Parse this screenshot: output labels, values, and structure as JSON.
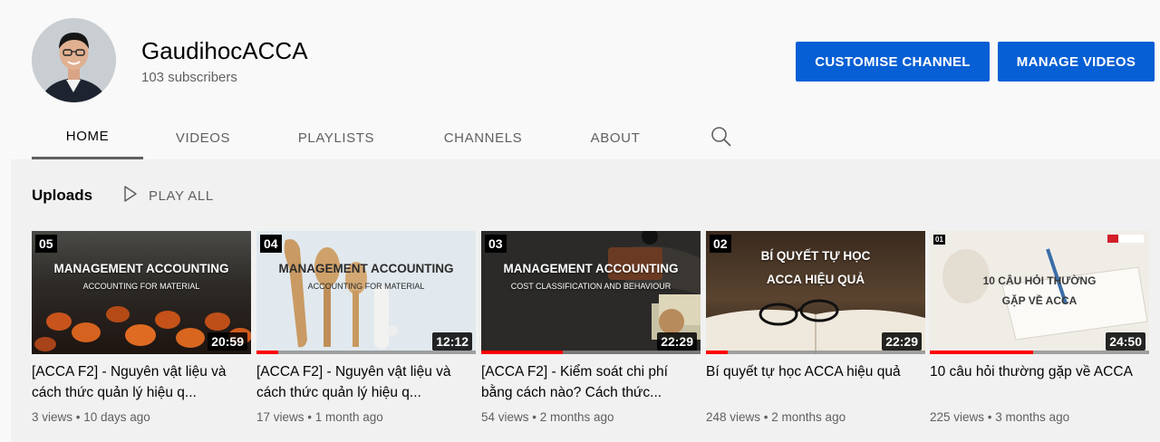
{
  "channel": {
    "name": "GaudihocACCA",
    "subscribers": "103 subscribers",
    "customise_label": "CUSTOMISE CHANNEL",
    "manage_label": "MANAGE VIDEOS"
  },
  "tabs": [
    {
      "label": "HOME",
      "active": true
    },
    {
      "label": "VIDEOS",
      "active": false
    },
    {
      "label": "PLAYLISTS",
      "active": false
    },
    {
      "label": "CHANNELS",
      "active": false
    },
    {
      "label": "ABOUT",
      "active": false
    }
  ],
  "shelf": {
    "title": "Uploads",
    "play_all": "PLAY ALL"
  },
  "videos": [
    {
      "episode": "05",
      "thumb_title": "MANAGEMENT ACCOUNTING",
      "thumb_sub": "ACCOUNTING FOR MATERIAL",
      "duration": "20:59",
      "watched": 0,
      "title": "[ACCA F2] - Nguyên vật liệu và cách thức quản lý hiệu q...",
      "views": "3 views",
      "age": "10 days ago"
    },
    {
      "episode": "04",
      "thumb_title": "MANAGEMENT ACCOUNTING",
      "thumb_sub": "ACCOUNTING FOR MATERIAL",
      "duration": "12:12",
      "watched": 0.1,
      "title": "[ACCA F2] - Nguyên vật liệu và cách thức quản lý hiệu q...",
      "views": "17 views",
      "age": "1 month ago"
    },
    {
      "episode": "03",
      "thumb_title": "MANAGEMENT ACCOUNTING",
      "thumb_sub": "COST CLASSIFICATION AND BEHAVIOUR",
      "duration": "22:29",
      "watched": 0.37,
      "title": "[ACCA F2] - Kiểm soát chi phí bằng cách nào? Cách thức...",
      "views": "54 views",
      "age": "2 months ago"
    },
    {
      "episode": "02",
      "thumb_title": "BÍ QUYẾT TỰ HỌC",
      "thumb_sub": "ACCA HIỆU QUẢ",
      "duration": "22:29",
      "watched": 0.1,
      "title": "Bí quyết tự học ACCA hiệu quả",
      "views": "248 views",
      "age": "2 months ago"
    },
    {
      "episode": "01",
      "thumb_title": "10 CÂU HỎI THƯỜNG",
      "thumb_sub": "GẶP VỀ ACCA",
      "duration": "24:50",
      "watched": 0.47,
      "title": "10 câu hỏi thường gặp về ACCA",
      "views": "225 views",
      "age": "3 months ago"
    }
  ],
  "colors": {
    "accent": "#065fd4",
    "progress": "#ff0000"
  }
}
